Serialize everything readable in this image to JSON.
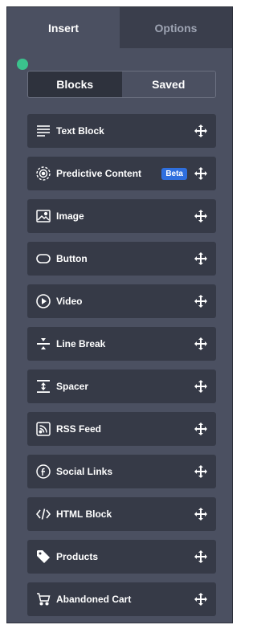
{
  "tabs": [
    {
      "label": "Insert",
      "active": true
    },
    {
      "label": "Options",
      "active": false
    }
  ],
  "segment": {
    "blocks_label": "Blocks",
    "saved_label": "Saved",
    "selected": "Blocks"
  },
  "blocks": [
    {
      "label": "Text Block",
      "icon": "text-lines-icon"
    },
    {
      "label": "Predictive Content",
      "icon": "target-icon",
      "badge": "Beta"
    },
    {
      "label": "Image",
      "icon": "image-icon"
    },
    {
      "label": "Button",
      "icon": "button-icon"
    },
    {
      "label": "Video",
      "icon": "play-icon"
    },
    {
      "label": "Line Break",
      "icon": "line-break-icon"
    },
    {
      "label": "Spacer",
      "icon": "spacer-icon"
    },
    {
      "label": "RSS Feed",
      "icon": "rss-icon"
    },
    {
      "label": "Social Links",
      "icon": "facebook-icon"
    },
    {
      "label": "HTML Block",
      "icon": "code-icon"
    },
    {
      "label": "Products",
      "icon": "tag-icon"
    },
    {
      "label": "Abandoned Cart",
      "icon": "cart-icon"
    }
  ],
  "colors": {
    "panel": "#4b5061",
    "block": "#363a47",
    "accent_dot": "#3bc28d",
    "badge": "#2f6fde"
  }
}
